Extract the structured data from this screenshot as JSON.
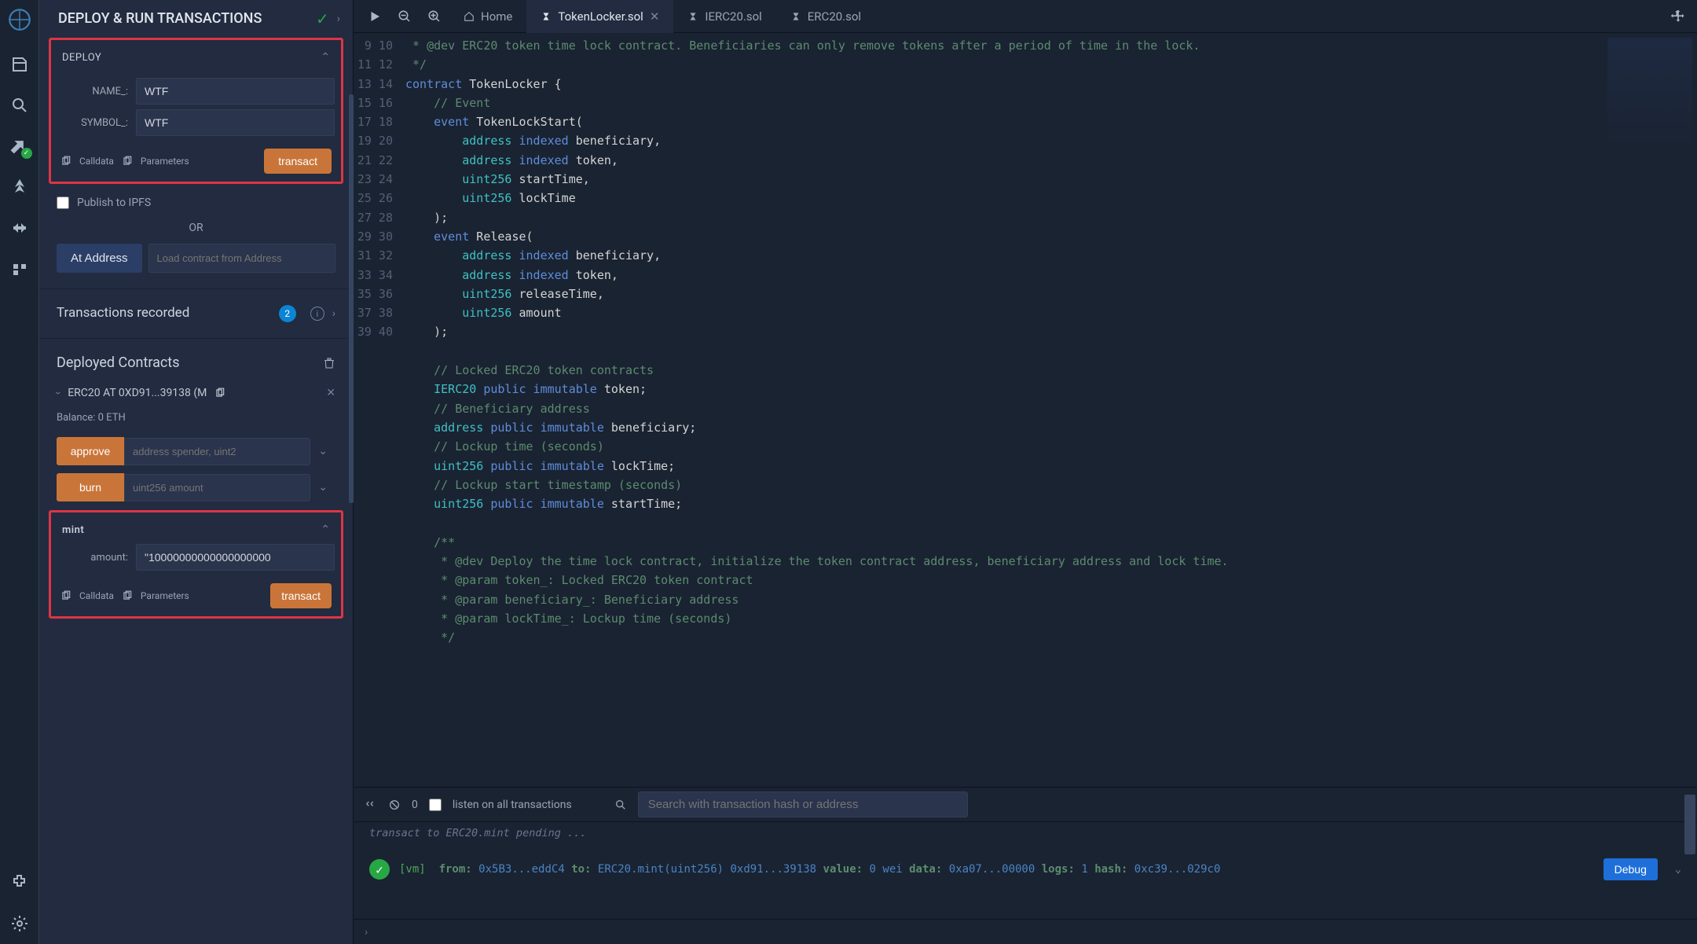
{
  "header": {
    "title": "DEPLOY & RUN TRANSACTIONS"
  },
  "deploy": {
    "section_label": "DEPLOY",
    "name_label": "NAME_:",
    "name_value": "WTF",
    "symbol_label": "SYMBOL_:",
    "symbol_value": "WTF",
    "calldata_label": "Calldata",
    "parameters_label": "Parameters",
    "transact_label": "transact"
  },
  "publish": {
    "label": "Publish to IPFS",
    "or_label": "OR",
    "at_address_label": "At Address",
    "load_placeholder": "Load contract from Address"
  },
  "tx_recorded": {
    "label": "Transactions recorded",
    "count": "2"
  },
  "deployed": {
    "label": "Deployed Contracts",
    "contract_name": "ERC20 AT 0XD91...39138 (M",
    "balance_label": "Balance: 0 ETH",
    "approve": {
      "label": "approve",
      "placeholder": "address spender, uint2"
    },
    "burn": {
      "label": "burn",
      "placeholder": "uint256 amount"
    },
    "mint": {
      "label": "mint",
      "amount_label": "amount:",
      "amount_value": "\"10000000000000000000",
      "calldata_label": "Calldata",
      "parameters_label": "Parameters",
      "transact_label": "transact"
    }
  },
  "tabs": {
    "home": "Home",
    "files": [
      "TokenLocker.sol",
      "IERC20.sol",
      "ERC20.sol"
    ]
  },
  "code": {
    "line_start": 9,
    "lines": [
      " * @dev ERC20 token time lock contract. Beneficiaries can only remove tokens after a period of time in the lock.",
      " */",
      "contract TokenLocker {",
      "    // Event",
      "    event TokenLockStart(",
      "        address indexed beneficiary,",
      "        address indexed token,",
      "        uint256 startTime,",
      "        uint256 lockTime",
      "    );",
      "    event Release(",
      "        address indexed beneficiary,",
      "        address indexed token,",
      "        uint256 releaseTime,",
      "        uint256 amount",
      "    );",
      "",
      "    // Locked ERC20 token contracts",
      "    IERC20 public immutable token;",
      "    // Beneficiary address",
      "    address public immutable beneficiary;",
      "    // Lockup time (seconds)",
      "    uint256 public immutable lockTime;",
      "    // Lockup start timestamp (seconds)",
      "    uint256 public immutable startTime;",
      "",
      "    /**",
      "     * @dev Deploy the time lock contract, initialize the token contract address, beneficiary address and lock time.",
      "     * @param token_: Locked ERC20 token contract",
      "     * @param beneficiary_: Beneficiary address",
      "     * @param lockTime_: Lockup time (seconds)",
      "     */"
    ]
  },
  "terminal": {
    "count": "0",
    "listen_label": "listen on all transactions",
    "search_placeholder": "Search with transaction hash or address",
    "pending_line": "transact to ERC20.mint pending ...",
    "log": {
      "vm": "[vm]",
      "from_k": "from:",
      "from_v": "0x5B3...eddC4",
      "to_k": "to:",
      "to_v": "ERC20.mint(uint256) 0xd91...39138",
      "value_k": "value:",
      "value_v": "0 wei",
      "data_k": "data:",
      "data_v": "0xa07...00000",
      "logs_k": "logs:",
      "logs_v": "1",
      "hash_k": "hash:",
      "hash_v": "0xc39...029c0"
    },
    "debug_label": "Debug"
  }
}
